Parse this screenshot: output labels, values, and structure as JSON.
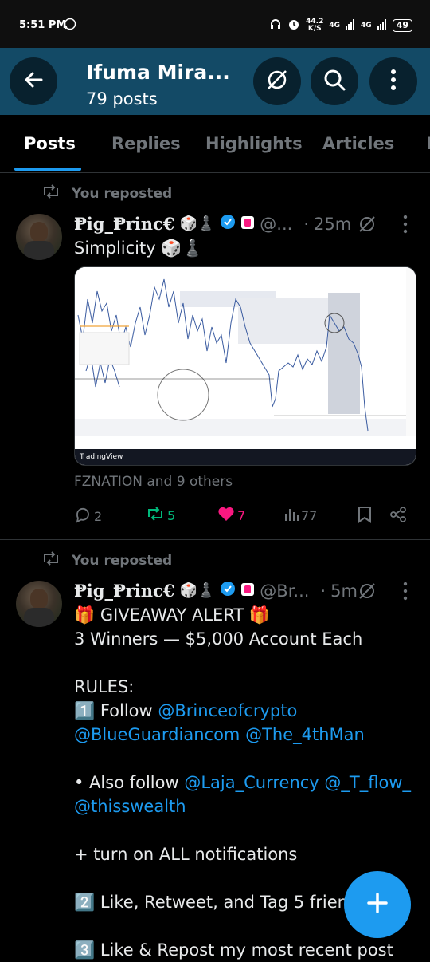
{
  "status_bar": {
    "time": "5:51 PM",
    "speed_value": "44.2",
    "speed_unit": "K/S",
    "network_1": "4G",
    "network_2": "4G",
    "battery": "49"
  },
  "header": {
    "title": "Ifuma Mira...",
    "post_count": "79 posts",
    "icons": [
      "back-arrow-icon",
      "grok-icon",
      "search-icon",
      "more-vertical-icon"
    ],
    "background_color": "#134a66"
  },
  "tabs": [
    {
      "label": "Posts",
      "active": true
    },
    {
      "label": "Replies",
      "active": false
    },
    {
      "label": "Highlights",
      "active": false
    },
    {
      "label": "Articles",
      "active": false
    },
    {
      "label": "M",
      "active": false
    }
  ],
  "posts": [
    {
      "repost_label": "You reposted",
      "display_name": "Ᵽig_Ᵽrinc€",
      "emojis": "🎲♟️",
      "handle": "@...",
      "separator": "·",
      "time": "25m",
      "text": "Simplicity 🎲♟️",
      "media_caption": "TradingView",
      "liked_by": "FZNATION and 9 others",
      "stats": {
        "replies": "2",
        "reposts": "5",
        "likes": "7",
        "views": "77"
      }
    },
    {
      "repost_label": "You reposted",
      "display_name": "Ᵽig_Ᵽrinc€",
      "emojis": "🎲♟️",
      "handle": "@Br...",
      "separator": "·",
      "time": "5m",
      "lines": {
        "l1": "🎁 GIVEAWAY ALERT 🎁",
        "l2": "3 Winners — $5,000 Account Each",
        "l3": "RULES:",
        "l4_prefix": "1️⃣ Follow ",
        "l4_link": "@Brinceofcrypto",
        "l5_link1": "@BlueGuardiancom",
        "l5_link2": "@The_4thMan",
        "l6_prefix": "• Also follow ",
        "l6_link1": "@Laja_Currency",
        "l6_link2": "@_T_flow_",
        "l7_link": "@thisswealth",
        "l8": "+ turn on ALL notifications",
        "l9": "2️⃣ Like, Retweet, and Tag 5 frien",
        "l10": "3️⃣ Like & Repost my most recent post"
      }
    }
  ],
  "colors": {
    "accent": "#1d9bf0",
    "repost_green": "#00ba7c",
    "like_pink": "#f91880"
  }
}
